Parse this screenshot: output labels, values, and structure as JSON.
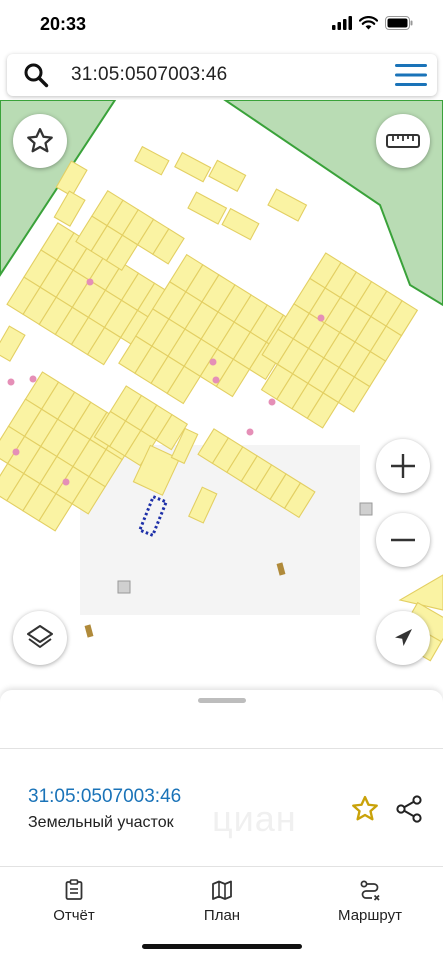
{
  "status_bar": {
    "time": "20:33",
    "icons": [
      "signal-icon",
      "wifi-icon",
      "battery-icon"
    ]
  },
  "search": {
    "query": "31:05:0507003:46",
    "icon": "search-icon",
    "menu_icon": "hamburger-menu-icon"
  },
  "map": {
    "controls": [
      "favorites-star-icon",
      "ruler-icon",
      "zoom-in-icon",
      "zoom-out-icon",
      "layers-icon",
      "location-arrow-icon"
    ],
    "colors": {
      "parcel_fill": "#faf3a3",
      "parcel_stroke": "#e3cf63",
      "forest_fill": "#b9dcb4",
      "forest_stroke": "#3aa23a",
      "selected_outline": "#1d2fa8",
      "marker": "#e58fb7"
    }
  },
  "sheet": {
    "parcel_id": "31:05:0507003:46",
    "parcel_type": "Земельный участок",
    "watermark": "циан",
    "actions": [
      "favorite-star-icon",
      "share-icon"
    ],
    "accent_color": "#1a73b8",
    "star_color": "#c9a20a"
  },
  "tabs": [
    {
      "label": "Отчёт",
      "icon": "report-icon"
    },
    {
      "label": "План",
      "icon": "map-plan-icon"
    },
    {
      "label": "Маршрут",
      "icon": "route-icon"
    }
  ]
}
